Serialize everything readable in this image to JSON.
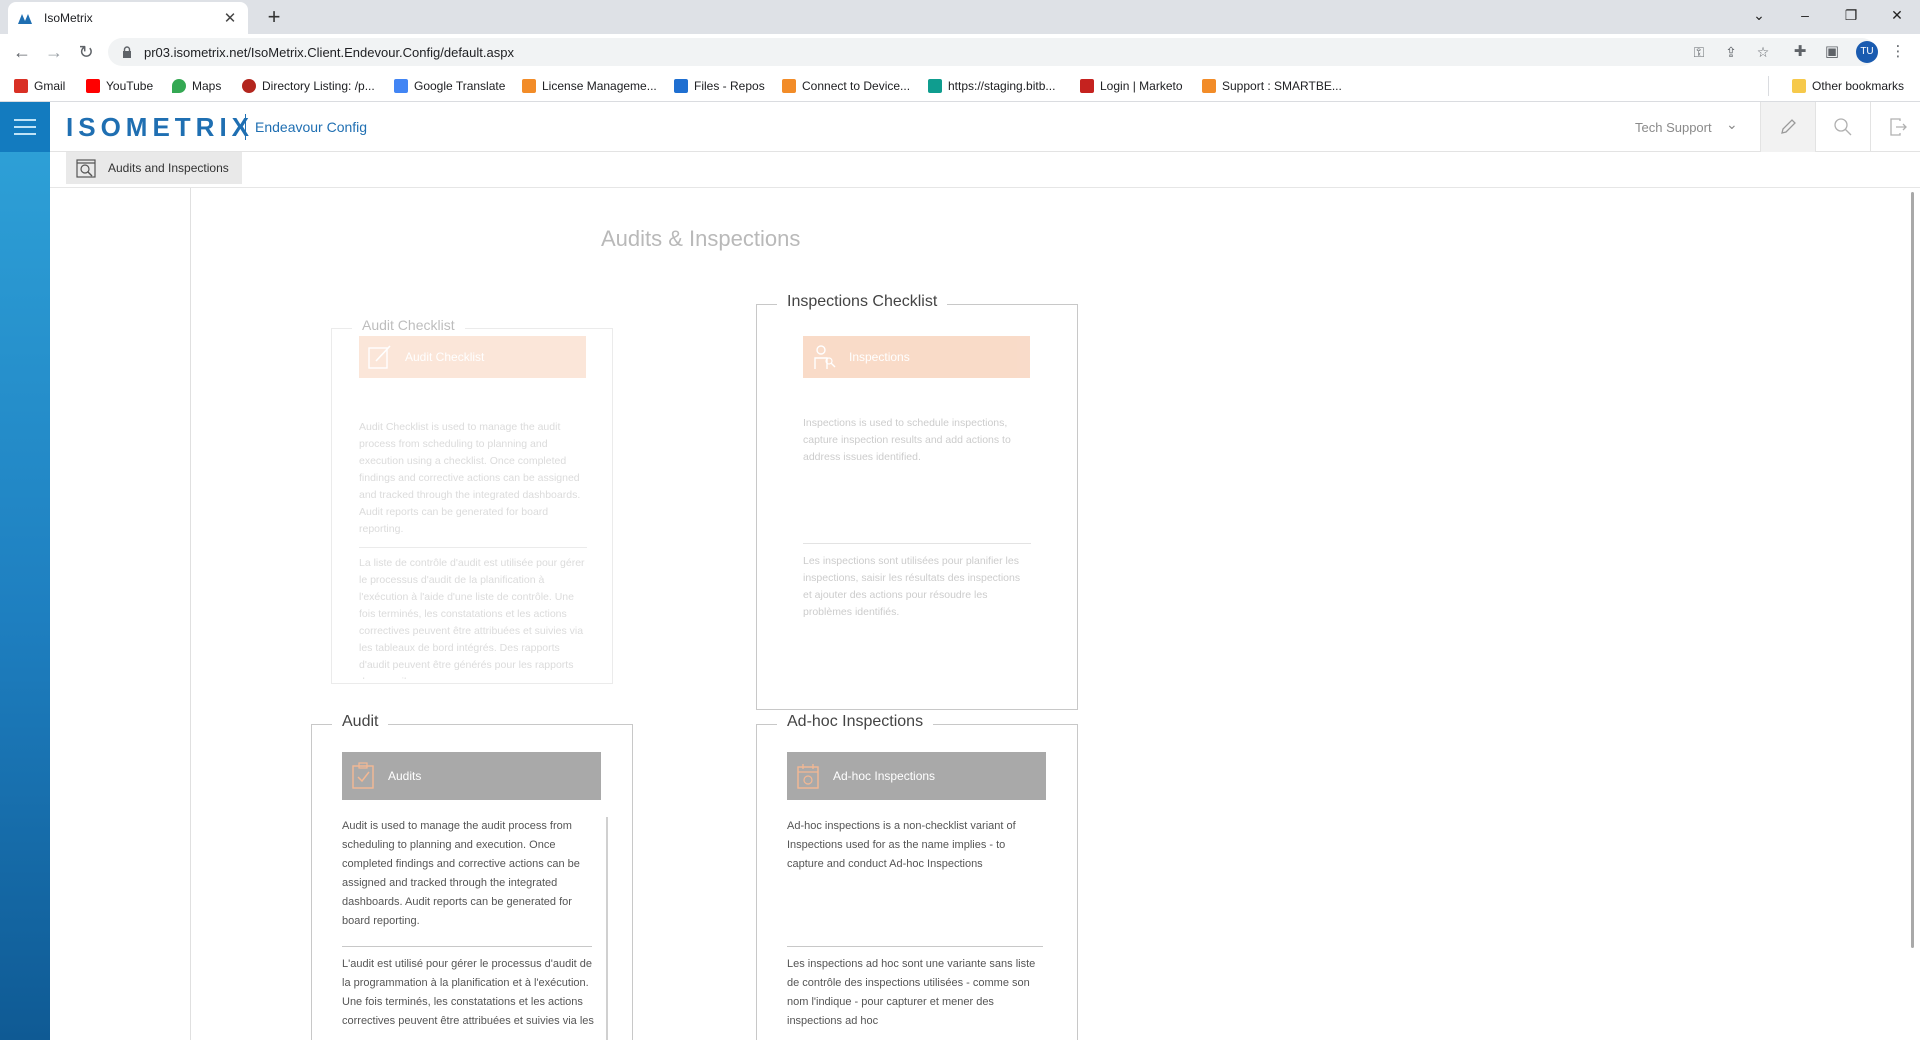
{
  "browser": {
    "tab_title": "IsoMetrix",
    "url": "pr03.isometrix.net/IsoMetrix.Client.Endevour.Config/default.aspx",
    "profile_initials": "TU",
    "bookmarks": [
      {
        "label": "Gmail",
        "color": "#d93025"
      },
      {
        "label": "YouTube",
        "color": "#ff0000"
      },
      {
        "label": "Maps",
        "color": "#34a853"
      },
      {
        "label": "Directory Listing: /p...",
        "color": "#b3261e"
      },
      {
        "label": "Google Translate",
        "color": "#4285f4"
      },
      {
        "label": "License Manageme...",
        "color": "#f28c28"
      },
      {
        "label": "Files - Repos",
        "color": "#1f6fd1"
      },
      {
        "label": "Connect to Device...",
        "color": "#f28c28"
      },
      {
        "label": "https://staging.bitb...",
        "color": "#0f9d8f"
      },
      {
        "label": "Login | Marketo",
        "color": "#c5221f"
      },
      {
        "label": "Support : SMARTBE...",
        "color": "#f28c28"
      }
    ],
    "other_bookmarks": "Other bookmarks"
  },
  "app": {
    "logo": "ISOMETRIX",
    "app_name": "Endeavour Config",
    "user": "Tech Support",
    "breadcrumb": "Audits and Inspections",
    "accent": "#1f6fb2"
  },
  "page": {
    "title": "Audits & Inspections",
    "cards": {
      "audit_checklist": {
        "legend": "Audit Checklist",
        "button": "Audit Checklist",
        "text_en": "Audit Checklist is used to manage the audit process from scheduling to planning and execution using a checklist. Once completed findings and corrective actions can be assigned and tracked through the integrated dashboards. Audit reports can be generated for board reporting.",
        "text_fr": "La liste de contrôle d'audit est utilisée pour gérer le processus d'audit de la planification à l'exécution à l'aide d'une liste de contrôle. Une fois terminés, les constatations et les actions correctives peuvent être attribuées et suivies via les tableaux de bord intégrés. Des rapports d'audit peuvent être générés pour les rapports du conseil."
      },
      "inspections_checklist": {
        "legend": "Inspections Checklist",
        "button": "Inspections",
        "text_en": "Inspections is used to schedule inspections, capture inspection results and add actions to address issues identified.",
        "text_fr": "Les inspections sont utilisées pour planifier les inspections, saisir les résultats des inspections et ajouter des actions pour résoudre les problèmes identifiés."
      },
      "audit": {
        "legend": "Audit",
        "button": "Audits",
        "text_en": "Audit is used to manage the audit process from scheduling to planning and execution. Once completed findings and corrective actions can be assigned and tracked through the integrated dashboards. Audit reports can be generated for board reporting.",
        "text_fr": "L'audit est utilisé pour gérer le processus d'audit de la programmation à la planification et à l'exécution. Une fois terminés, les constatations et les actions correctives peuvent être attribuées et suivies via les tableaux de"
      },
      "adhoc": {
        "legend": "Ad-hoc Inspections",
        "button": "Ad-hoc Inspections",
        "text_en": "Ad-hoc inspections is a non-checklist variant of Inspections used for as the name implies - to capture and conduct Ad-hoc Inspections",
        "text_fr": "Les inspections ad hoc sont une variante sans liste de contrôle des inspections utilisées - comme son nom l'indique - pour capturer et mener des inspections ad hoc"
      }
    }
  }
}
